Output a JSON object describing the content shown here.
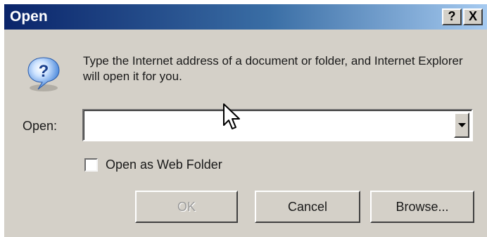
{
  "window": {
    "title": "Open",
    "help_label": "?",
    "close_label": "X"
  },
  "message": "Type the Internet address of a document or folder, and Internet Explorer will open it for you.",
  "open_field": {
    "label": "Open:",
    "value": ""
  },
  "checkbox": {
    "label": "Open as Web Folder",
    "checked": false
  },
  "buttons": {
    "ok": "OK",
    "cancel": "Cancel",
    "browse": "Browse..."
  },
  "icons": {
    "message_icon": "question-icon",
    "dropdown_icon": "chevron-down-icon",
    "cursor": "mouse-pointer-icon"
  },
  "colors": {
    "titlebar_start": "#0a246a",
    "titlebar_end": "#a6caf0",
    "dialog_face": "#d4d0c8"
  }
}
